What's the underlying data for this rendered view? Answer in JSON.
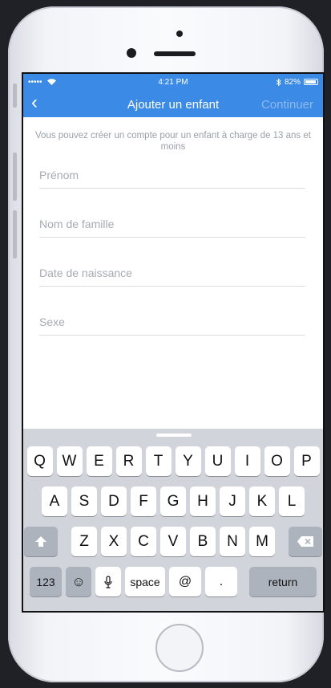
{
  "status_bar": {
    "signal": "•••••",
    "time": "4:21 PM",
    "battery": "82%"
  },
  "nav": {
    "back_icon": "chevron-left-icon",
    "back_glyph": "‹",
    "title": "Ajouter un enfant",
    "continue_label": "Continuer"
  },
  "info_text": "Vous pouvez créer un compte pour un enfant à charge de 13 ans et moins",
  "fields": {
    "prenom": "Prénom",
    "nom": "Nom de famille",
    "date": "Date de naissance",
    "sexe": "Sexe"
  },
  "keyboard": {
    "row1": [
      "Q",
      "W",
      "E",
      "R",
      "T",
      "Y",
      "U",
      "I",
      "O",
      "P"
    ],
    "row2": [
      "A",
      "S",
      "D",
      "F",
      "G",
      "H",
      "J",
      "K",
      "L"
    ],
    "row3": [
      "Z",
      "X",
      "C",
      "V",
      "B",
      "N",
      "M"
    ],
    "numbers": "123",
    "emoji": "☺",
    "mic": "🎙",
    "space": "space",
    "at": "@",
    "period": ".",
    "return": "return",
    "shift_icon": "shift-icon",
    "delete_icon": "delete-icon"
  },
  "colors": {
    "accent": "#3b8ae6",
    "continue_disabled": "#8fbaf0",
    "keyboard_bg": "#d1d4db"
  }
}
